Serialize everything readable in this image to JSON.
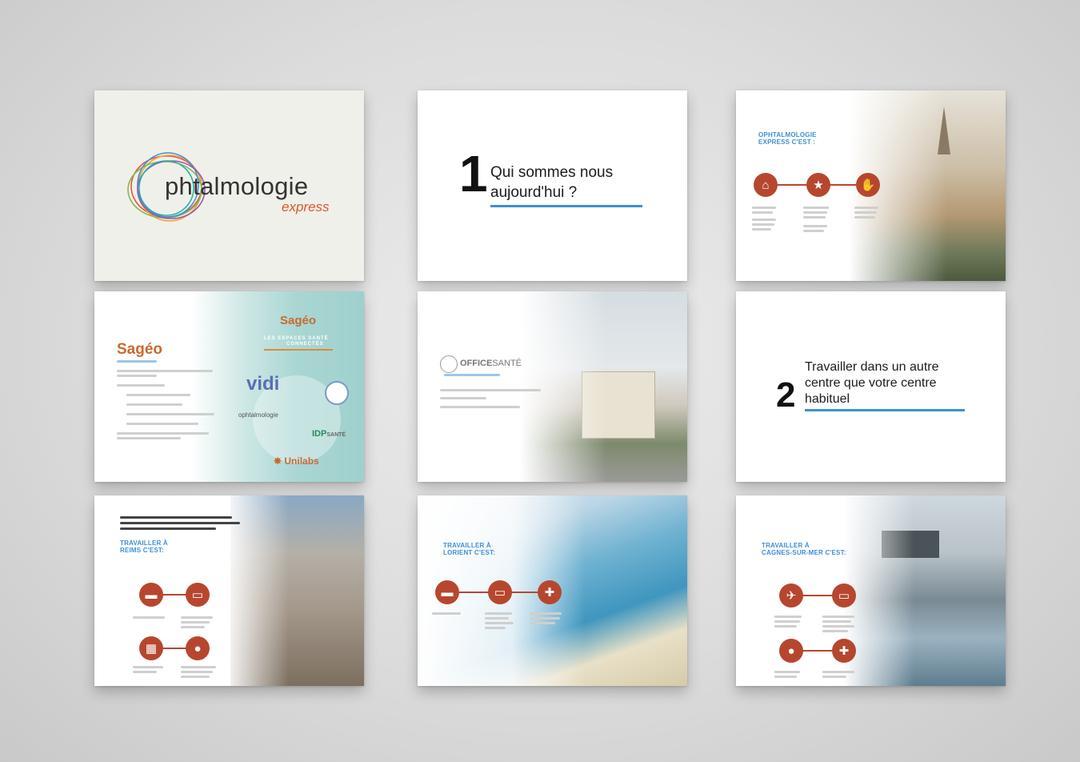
{
  "slides": {
    "logo": {
      "word": "phtalmologie",
      "sub": "express"
    },
    "s1": {
      "num": "1",
      "line1": "Qui sommes nous",
      "line2": "aujourd'hui ?"
    },
    "s3": {
      "heading1": "OPHTALMOLOGIE",
      "heading2": "EXPRESS C'EST :"
    },
    "sageo": {
      "title": "Sagéo",
      "tag": "Sagéo",
      "banner1": "LES ESPACES SANTÉ",
      "banner2": "CONNECTÉS",
      "vidi": "vidi",
      "idp": "IDP",
      "idp_suffix": "SANTÉ",
      "unilabs": "Unilabs",
      "oph": "ophtalmologie"
    },
    "office": {
      "name_bold": "OFFICE",
      "name_rest": "SANTÉ"
    },
    "s2": {
      "num": "2",
      "line1": "Travailler dans un autre",
      "line2": "centre que votre centre",
      "line3": "habituel"
    },
    "reims": {
      "heading1": "TRAVAILLER À",
      "heading2": "REIMS C'EST:"
    },
    "lorient": {
      "heading1": "TRAVAILLER À",
      "heading2": "LORIENT C'EST:"
    },
    "cagnes": {
      "heading1": "TRAVAILLER À",
      "heading2": "CAGNES-SUR-MER C'EST:"
    }
  },
  "icons": [
    "home-icon",
    "star-icon",
    "handshake-icon",
    "train-icon",
    "bed-icon",
    "hospital-icon",
    "building-icon",
    "group-icon",
    "plane-icon"
  ],
  "colors": {
    "accent_blue": "#3d8fd6",
    "icon_red": "#b6472e",
    "sageo_orange": "#c96a2e",
    "teal": "#a9d6d3"
  }
}
